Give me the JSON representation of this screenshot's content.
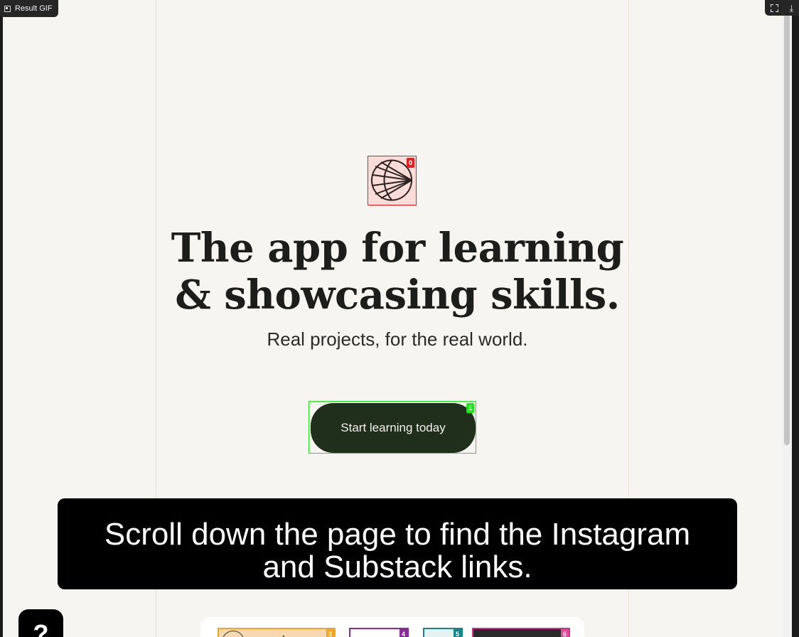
{
  "viewer": {
    "badge_label": "Result GIF",
    "badge_icon": "image-icon",
    "tools": [
      "expand-icon",
      "download-icon"
    ]
  },
  "hero": {
    "logo_icon": "fan-logo-icon",
    "logo_marker": "0",
    "title_line1": "The app for learning",
    "title_line2": "& showcasing skills.",
    "subtitle": "Real projects, for the real world.",
    "cta_label": "Start learning today",
    "cta_marker": "1"
  },
  "caption": {
    "line1": "Scroll down the page to find the Instagram",
    "line2": "and Substack links."
  },
  "help_button": {
    "label": "?"
  },
  "bottom_strip": {
    "chips": [
      {
        "text": "nextwo",
        "marker": "3"
      },
      {
        "text": "",
        "marker": "4"
      },
      {
        "text": "",
        "marker": "5"
      },
      {
        "text": "",
        "marker": "6"
      }
    ]
  },
  "colors": {
    "page_bg": "#f7f5f1",
    "cta_bg": "#1f2f1b",
    "marker_red": "#e0201f",
    "marker_green": "#1ee31a"
  }
}
